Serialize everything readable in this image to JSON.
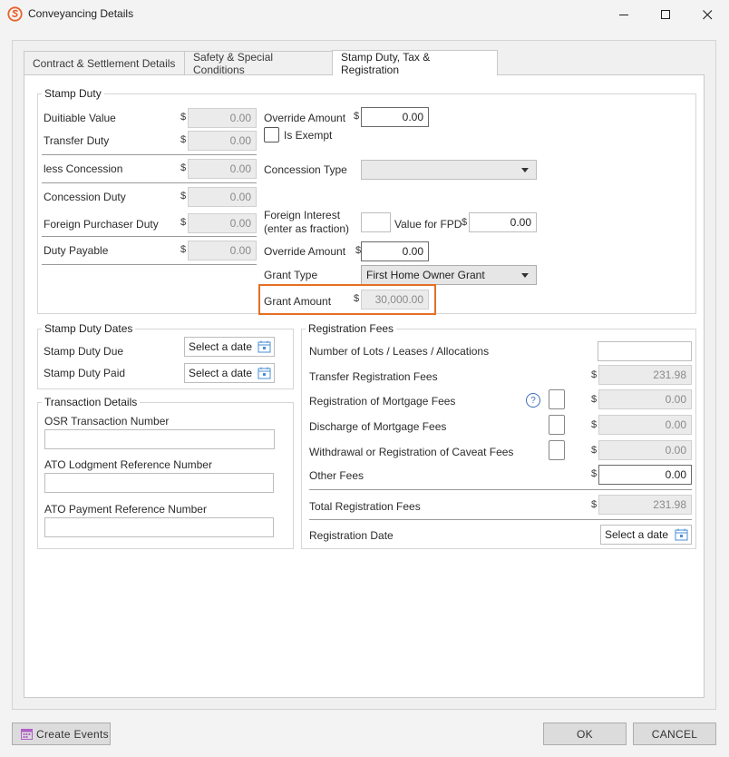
{
  "window": {
    "title": "Conveyancing Details"
  },
  "tabs": [
    {
      "label": "Contract & Settlement Details"
    },
    {
      "label": "Safety & Special Conditions"
    },
    {
      "label": "Stamp Duty, Tax & Registration"
    }
  ],
  "stamp_duty": {
    "legend": "Stamp Duty",
    "currency": "$",
    "dutiable_value": {
      "label": "Duitiable Value",
      "value": "0.00"
    },
    "transfer_duty": {
      "label": "Transfer Duty",
      "value": "0.00"
    },
    "less_concession": {
      "label": "less Concession",
      "value": "0.00"
    },
    "concession_duty": {
      "label": "Concession Duty",
      "value": "0.00"
    },
    "foreign_purchaser_duty": {
      "label": "Foreign Purchaser Duty",
      "value": "0.00"
    },
    "duty_payable": {
      "label": "Duty Payable",
      "value": "0.00"
    },
    "override_amount_1": {
      "label": "Override Amount",
      "value": "0.00"
    },
    "is_exempt": {
      "label": "Is Exempt"
    },
    "concession_type": {
      "label": "Concession Type",
      "value": ""
    },
    "foreign_interest": {
      "label_line1": "Foreign Interest",
      "label_line2": "(enter as fraction)",
      "value": ""
    },
    "value_for_fpd": {
      "label": "Value for FPD",
      "value": "0.00"
    },
    "override_amount_2": {
      "label": "Override Amount",
      "value": "0.00"
    },
    "grant_type": {
      "label": "Grant Type",
      "value": "First Home Owner Grant"
    },
    "grant_amount": {
      "label": "Grant Amount",
      "value": "30,000.00"
    }
  },
  "stamp_duty_dates": {
    "legend": "Stamp Duty Dates",
    "due_label": "Stamp Duty Due",
    "paid_label": "Stamp Duty Paid",
    "date_placeholder": "Select a date"
  },
  "transaction_details": {
    "legend": "Transaction Details",
    "osr_label": "OSR Transaction Number",
    "ato_lodgment_label": "ATO Lodgment Reference Number",
    "ato_payment_label": "ATO Payment Reference Number"
  },
  "registration_fees": {
    "legend": "Registration Fees",
    "currency": "$",
    "lots_label": "Number of Lots / Leases / Allocations",
    "lots_value": "",
    "transfer_label": "Transfer Registration Fees",
    "transfer_value": "231.98",
    "mortgage_label": "Registration of Mortgage Fees",
    "mortgage_value": "0.00",
    "help_glyph": "?",
    "discharge_label": "Discharge of Mortgage Fees",
    "discharge_value": "0.00",
    "caveat_label": "Withdrawal or Registration of Caveat Fees",
    "caveat_value": "0.00",
    "other_label": "Other Fees",
    "other_value": "0.00",
    "total_label": "Total Registration Fees",
    "total_value": "231.98",
    "reg_date_label": "Registration Date",
    "date_placeholder": "Select a date"
  },
  "footer": {
    "create_events": "Create Events",
    "ok": "OK",
    "cancel": "CANCEL"
  },
  "colors": {
    "highlight": "#e46f24",
    "accent_icon": "#e8622c",
    "calendar_icon": "#4a8fd6",
    "create_events_icon": "#b05ec7"
  }
}
